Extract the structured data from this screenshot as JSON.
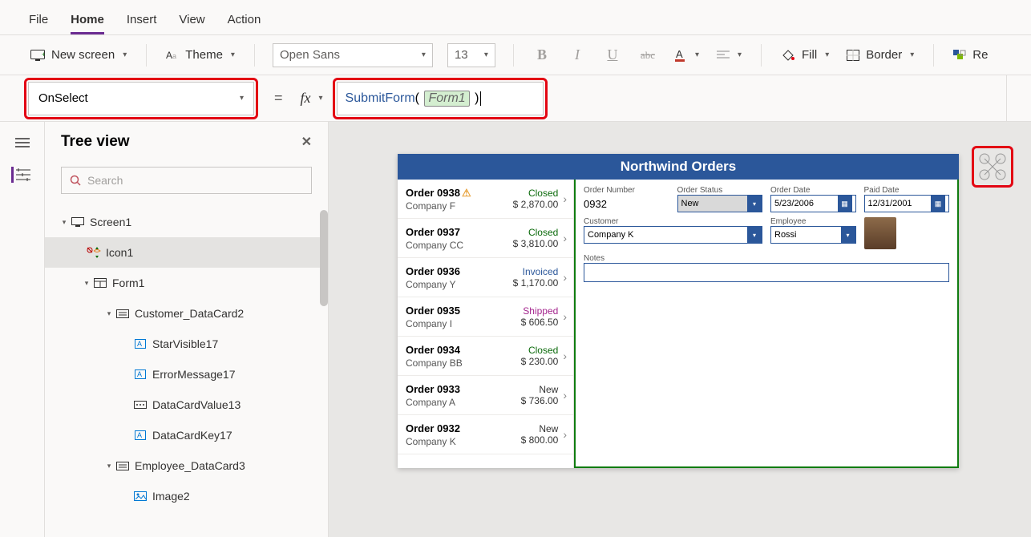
{
  "menu": {
    "file": "File",
    "home": "Home",
    "insert": "Insert",
    "view": "View",
    "action": "Action"
  },
  "toolbar": {
    "new_screen": "New screen",
    "theme": "Theme",
    "font": "Open Sans",
    "font_size": "13",
    "fill": "Fill",
    "border": "Border",
    "reorder": "Re"
  },
  "formula": {
    "property": "OnSelect",
    "fx": "fx",
    "fn": "SubmitForm",
    "arg": "Form1"
  },
  "tree": {
    "title": "Tree view",
    "search_placeholder": "Search",
    "nodes": {
      "screen": "Screen1",
      "icon1": "Icon1",
      "form1": "Form1",
      "customer_card": "Customer_DataCard2",
      "star": "StarVisible17",
      "err": "ErrorMessage17",
      "dcv": "DataCardValue13",
      "dck": "DataCardKey17",
      "emp_card": "Employee_DataCard3",
      "image2": "Image2"
    }
  },
  "app": {
    "title": "Northwind Orders",
    "orders": [
      {
        "id": "Order 0938",
        "company": "Company F",
        "status": "Closed",
        "status_color": "#0b6a0b",
        "amount": "$ 2,870.00",
        "warn": true
      },
      {
        "id": "Order 0937",
        "company": "Company CC",
        "status": "Closed",
        "status_color": "#0b6a0b",
        "amount": "$ 3,810.00"
      },
      {
        "id": "Order 0936",
        "company": "Company Y",
        "status": "Invoiced",
        "status_color": "#2b579a",
        "amount": "$ 1,170.00"
      },
      {
        "id": "Order 0935",
        "company": "Company I",
        "status": "Shipped",
        "status_color": "#a4268e",
        "amount": "$ 606.50"
      },
      {
        "id": "Order 0934",
        "company": "Company BB",
        "status": "Closed",
        "status_color": "#0b6a0b",
        "amount": "$ 230.00"
      },
      {
        "id": "Order 0933",
        "company": "Company A",
        "status": "New",
        "status_color": "#333",
        "amount": "$ 736.00"
      },
      {
        "id": "Order 0932",
        "company": "Company K",
        "status": "New",
        "status_color": "#333",
        "amount": "$ 800.00"
      }
    ],
    "labels": {
      "order_number": "Order Number",
      "order_status": "Order Status",
      "order_date": "Order Date",
      "paid_date": "Paid Date",
      "customer": "Customer",
      "employee": "Employee",
      "notes": "Notes"
    },
    "values": {
      "order_number": "0932",
      "order_status": "New",
      "order_date": "5/23/2006",
      "paid_date": "12/31/2001",
      "customer": "Company K",
      "employee": "Rossi"
    }
  }
}
